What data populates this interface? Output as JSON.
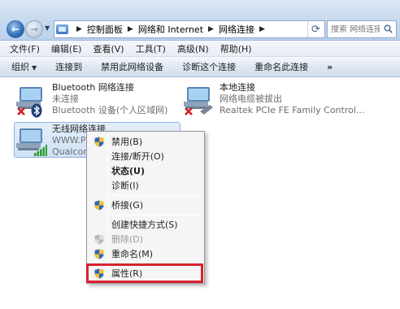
{
  "address": {
    "crumbs": [
      "控制面板",
      "网络和 Internet",
      "网络连接"
    ],
    "search_placeholder": "搜索 网络连接"
  },
  "menubar": {
    "items": [
      "文件(F)",
      "编辑(E)",
      "查看(V)",
      "工具(T)",
      "高级(N)",
      "帮助(H)"
    ]
  },
  "commandbar": {
    "organize": "组织",
    "items": [
      "连接到",
      "禁用此网络设备",
      "诊断这个连接",
      "重命名此连接"
    ],
    "more": "»"
  },
  "connections": [
    {
      "name": "Bluetooth 网络连接",
      "status": "未连接",
      "device": "Bluetooth 设备(个人区域网)"
    },
    {
      "name": "本地连接",
      "status": "网络电缆被拔出",
      "device": "Realtek PCIe FE Family Control..."
    },
    {
      "name": "无线网络连接",
      "status": "WWW.PC",
      "device": "Qualcom"
    }
  ],
  "context_menu": {
    "items": [
      {
        "label": "禁用(B)",
        "icon": "shield-icon"
      },
      {
        "label": "连接/断开(O)"
      },
      {
        "label": "状态(U)",
        "bold": true
      },
      {
        "label": "诊断(I)"
      },
      {
        "label": "桥接(G)",
        "icon": "shield-icon"
      },
      {
        "label": "创建快捷方式(S)"
      },
      {
        "label": "删除(D)",
        "icon": "shield-icon",
        "disabled": true
      },
      {
        "label": "重命名(M)",
        "icon": "shield-icon"
      },
      {
        "label": "属性(R)",
        "icon": "shield-icon",
        "highlighted": true
      }
    ]
  },
  "colors": {
    "highlight_border": "#d6222d",
    "selection_fill": "#cfe1f5"
  }
}
